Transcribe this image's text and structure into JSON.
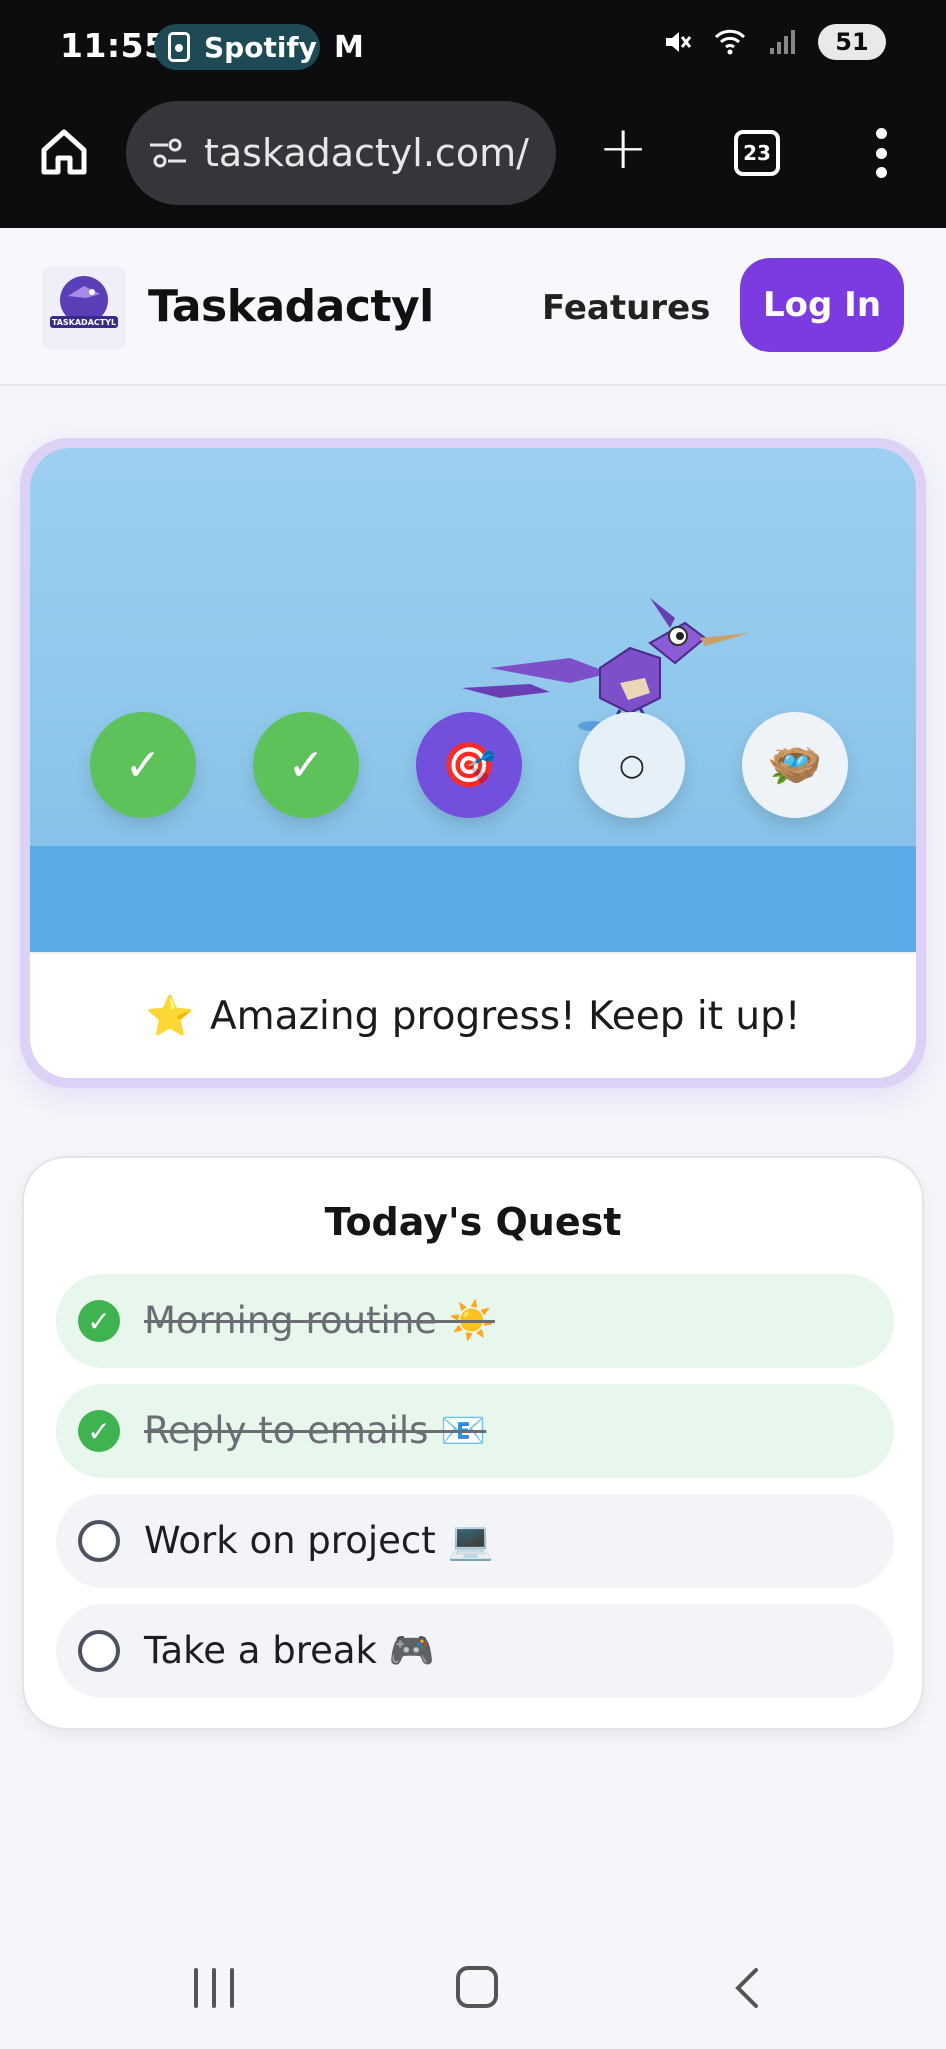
{
  "status_bar": {
    "time": "11:55",
    "notification_app": "Spotify",
    "gmail_icon": "M",
    "battery": "51",
    "icons": [
      "mute-icon",
      "wifi-icon",
      "signal-icon"
    ]
  },
  "browser": {
    "url": "taskadactyl.com/",
    "tab_count": "23",
    "new_tab_label": "+"
  },
  "header": {
    "brand": "Taskadactyl",
    "nav_features": "Features",
    "login_label": "Log In"
  },
  "hero": {
    "steps": [
      {
        "state": "done",
        "glyph": "✓"
      },
      {
        "state": "done",
        "glyph": "✓"
      },
      {
        "state": "current",
        "glyph": "🎯"
      },
      {
        "state": "todo",
        "glyph": "○"
      },
      {
        "state": "nest",
        "glyph": "🪺"
      }
    ],
    "message_emoji": "⭐",
    "message": "Amazing progress! Keep it up!",
    "colors": {
      "sky": "#9ccff0",
      "water": "#5aabe6",
      "done": "#5ec25a",
      "current": "#7250db"
    }
  },
  "quest": {
    "title": "Today's Quest",
    "items": [
      {
        "label": "Morning routine ☀️",
        "done": true
      },
      {
        "label": "Reply to emails 📧",
        "done": true
      },
      {
        "label": "Work on project 💻",
        "done": false
      },
      {
        "label": "Take a break 🎮",
        "done": false
      }
    ]
  },
  "accent": "#7b3be0"
}
